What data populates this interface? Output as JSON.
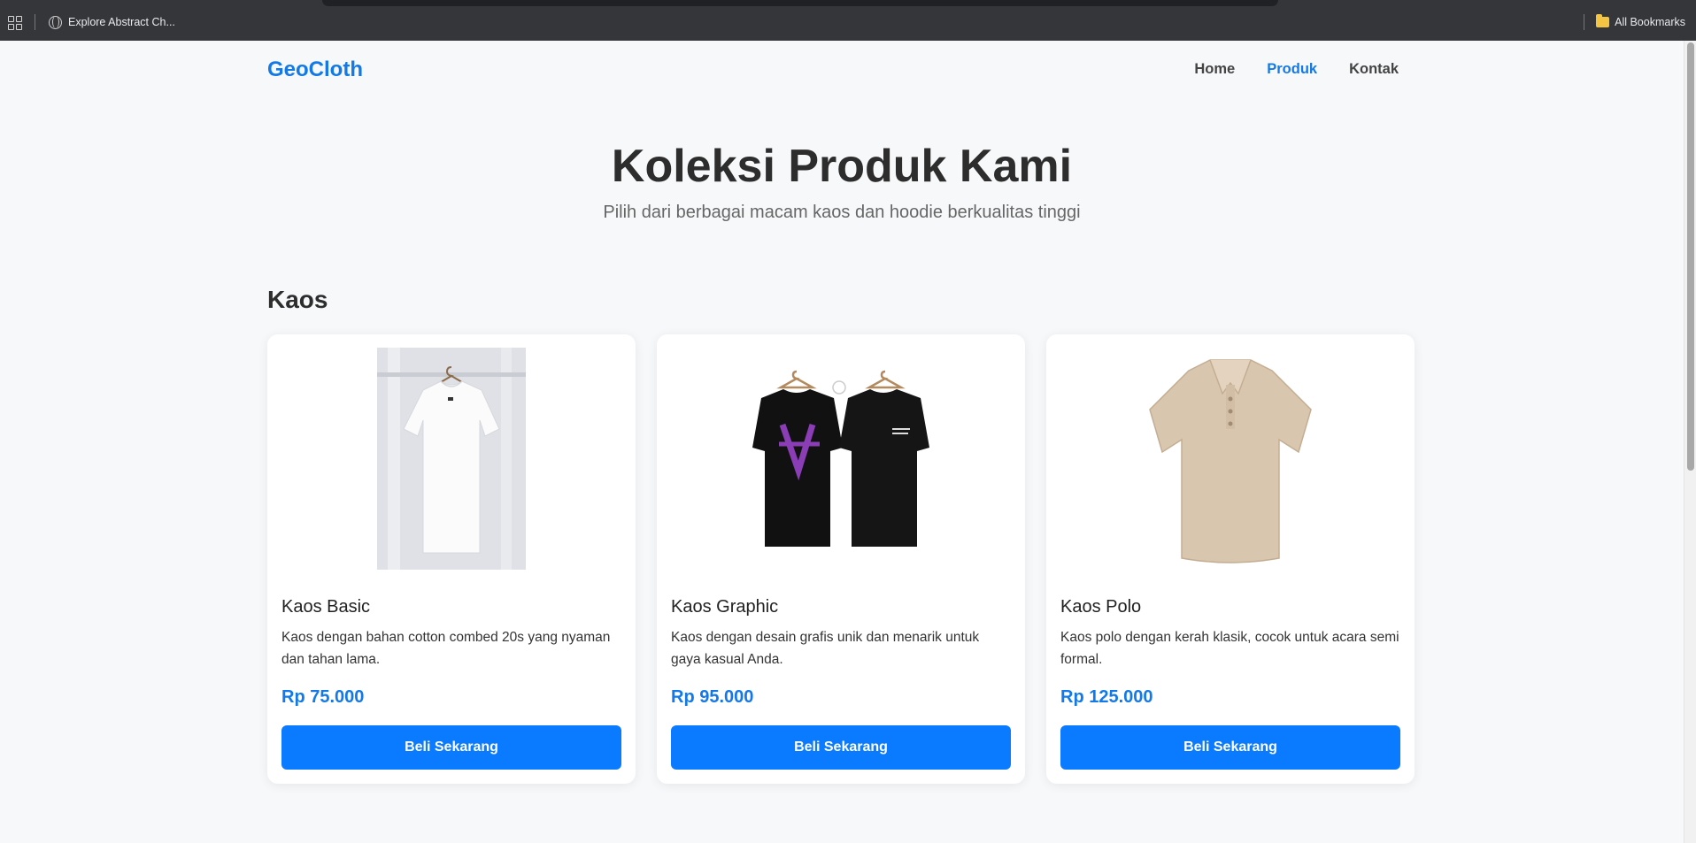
{
  "browser": {
    "bookmark_tab": "Explore Abstract Ch...",
    "all_bookmarks": "All Bookmarks"
  },
  "site": {
    "logo": "GeoCloth",
    "nav": [
      {
        "label": "Home",
        "active": false
      },
      {
        "label": "Produk",
        "active": true
      },
      {
        "label": "Kontak",
        "active": false
      }
    ]
  },
  "hero": {
    "title": "Koleksi Produk Kami",
    "subtitle": "Pilih dari berbagai macam kaos dan hoodie berkualitas tinggi"
  },
  "section": {
    "title": "Kaos"
  },
  "products": [
    {
      "name": "Kaos Basic",
      "description": "Kaos dengan bahan cotton combed 20s yang nyaman dan tahan lama.",
      "price": "Rp 75.000",
      "button": "Beli Sekarang"
    },
    {
      "name": "Kaos Graphic",
      "description": "Kaos dengan desain grafis unik dan menarik untuk gaya kasual Anda.",
      "price": "Rp 95.000",
      "button": "Beli Sekarang"
    },
    {
      "name": "Kaos Polo",
      "description": "Kaos polo dengan kerah klasik, cocok untuk acara semi formal.",
      "price": "Rp 125.000",
      "button": "Beli Sekarang"
    }
  ],
  "colors": {
    "accent": "#1479e8",
    "button": "#0a7aff",
    "background": "#f6f8fa"
  }
}
